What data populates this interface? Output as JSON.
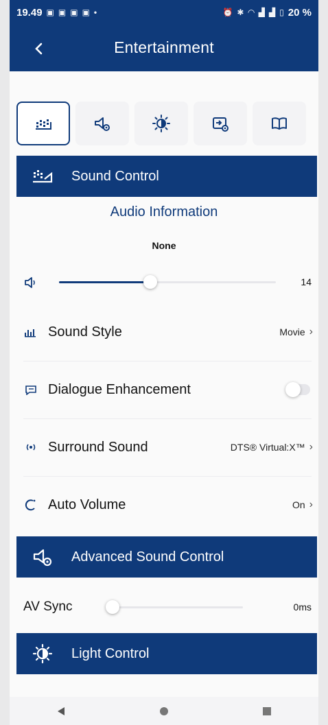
{
  "status_bar": {
    "time": "19.49",
    "battery": "20 %"
  },
  "app_bar": {
    "title": "Entertainment"
  },
  "tabs": [
    {
      "icon": "equalizer-icon",
      "active": true
    },
    {
      "icon": "speaker-gear-icon",
      "active": false
    },
    {
      "icon": "brightness-icon",
      "active": false
    },
    {
      "icon": "input-settings-icon",
      "active": false
    },
    {
      "icon": "book-icon",
      "active": false
    }
  ],
  "sound_control": {
    "header": "Sound Control",
    "audio_info_label": "Audio Information",
    "audio_info_value": "None",
    "volume": {
      "value": "14",
      "level": 14,
      "max": 100
    },
    "sound_style": {
      "label": "Sound Style",
      "value": "Movie"
    },
    "dialogue_enhancement": {
      "label": "Dialogue Enhancement",
      "enabled": false
    },
    "surround_sound": {
      "label": "Surround Sound",
      "value": "DTS® Virtual:X™"
    },
    "auto_volume": {
      "label": "Auto Volume",
      "value": "On"
    }
  },
  "advanced_sound_control": {
    "header": "Advanced Sound Control",
    "av_sync": {
      "label": "AV Sync",
      "value": "0ms"
    }
  },
  "light_control": {
    "header": "Light Control"
  },
  "colors": {
    "brand": "#0f3a7a"
  }
}
